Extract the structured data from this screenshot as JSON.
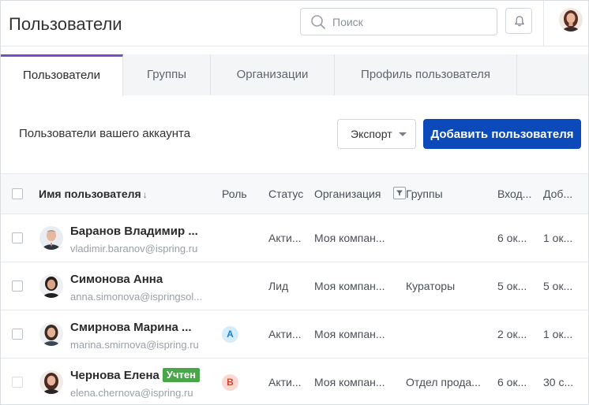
{
  "header": {
    "title": "Пользователи",
    "search_placeholder": "Поиск",
    "bell_icon": "bell-icon",
    "avatar_icon": "user-avatar"
  },
  "tabs": [
    {
      "label": "Пользователи",
      "active": true
    },
    {
      "label": "Группы",
      "active": false
    },
    {
      "label": "Организации",
      "active": false
    },
    {
      "label": "Профиль пользователя",
      "active": false
    }
  ],
  "toolbar": {
    "subtitle": "Пользователи вашего аккаунта",
    "export_label": "Экспорт",
    "add_label": "Добавить пользователя"
  },
  "colors": {
    "accent": "#7b4cc7",
    "primary_button": "#0b4ab8",
    "tag_green": "#4ba64b"
  },
  "table": {
    "columns": {
      "name": "Имя пользователя",
      "name_sort": "↓",
      "role": "Роль",
      "status": "Статус",
      "org": "Организация",
      "groups": "Группы",
      "login": "Вход...",
      "added": "Доб..."
    },
    "rows": [
      {
        "name": "Баранов Владимир ...",
        "email": "vladimir.baranov@ispring.ru",
        "role": "",
        "status": "Акти...",
        "org": "Моя компан...",
        "groups": "",
        "login": "6 ок...",
        "added": "1 ок...",
        "tag": ""
      },
      {
        "name": "Симонова Анна",
        "email": "anna.simonova@ispringsol...",
        "role": "",
        "status": "Лид",
        "org": "Моя компан...",
        "groups": "Кураторы",
        "login": "5 ок...",
        "added": "5 ок...",
        "tag": ""
      },
      {
        "name": "Смирнова Марина ...",
        "email": "marina.smirnova@ispring.ru",
        "role": "A",
        "status": "Акти...",
        "org": "Моя компан...",
        "groups": "",
        "login": "2 ок...",
        "added": "1 ок...",
        "tag": ""
      },
      {
        "name": "Чернова Елена",
        "email": "elena.chernova@ispring.ru",
        "role": "B",
        "status": "Акти...",
        "org": "Моя компан...",
        "groups": "Отдел прода...",
        "login": "6 ок...",
        "added": "30 с...",
        "tag": "Учтен"
      }
    ]
  }
}
